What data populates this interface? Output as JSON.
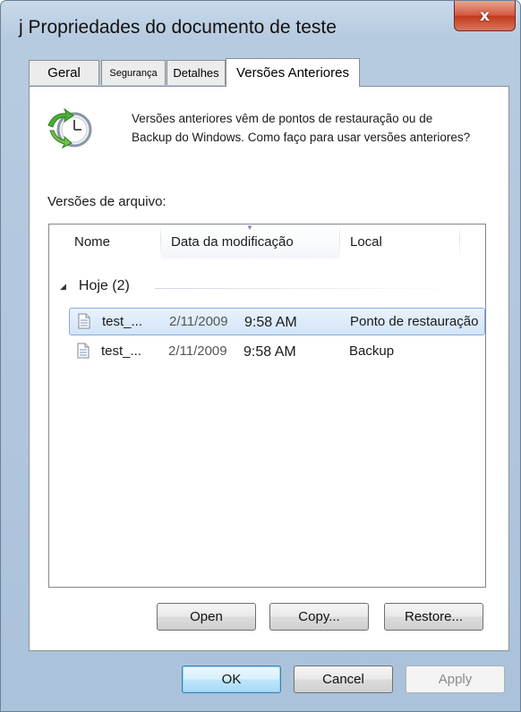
{
  "window": {
    "title": "j Propriedades do documento de teste",
    "close_label": "x"
  },
  "tabs": [
    {
      "label": "Geral",
      "active": false
    },
    {
      "label": "Segurança",
      "active": false
    },
    {
      "label": "Detalhes",
      "active": false
    },
    {
      "label": "Versões Anteriores",
      "active": true
    }
  ],
  "panel": {
    "icon": "restore-clock-icon",
    "description_line1": "Versões anteriores vêm de pontos de restauração ou de",
    "description_line2": "Backup do Windows. Como faço para usar versões anteriores?",
    "versions_label": "Versões de arquivo:"
  },
  "list": {
    "columns": [
      "Nome",
      "Data da modificação",
      "Local"
    ],
    "group": {
      "label": "Hoje (2)"
    },
    "rows": [
      {
        "name": "test_...",
        "date": "2/11/2009",
        "time": "9:58 AM",
        "location": "Ponto de restauração",
        "selected": true,
        "icon": "document-icon"
      },
      {
        "name": "test_...",
        "date": "2/11/2009",
        "time": "9:58 AM",
        "location": "Backup",
        "selected": false,
        "icon": "document-icon"
      }
    ]
  },
  "actions": {
    "open": "Open",
    "copy": "Copy...",
    "restore": "Restore..."
  },
  "dialog_buttons": {
    "ok": "OK",
    "cancel": "Cancel",
    "apply": "Apply",
    "apply_enabled": false
  },
  "colors": {
    "frame": "#b7cbe0",
    "close_button": "#c23a1d",
    "selection": "#d3e4f8",
    "selection_border": "#84acdd"
  }
}
